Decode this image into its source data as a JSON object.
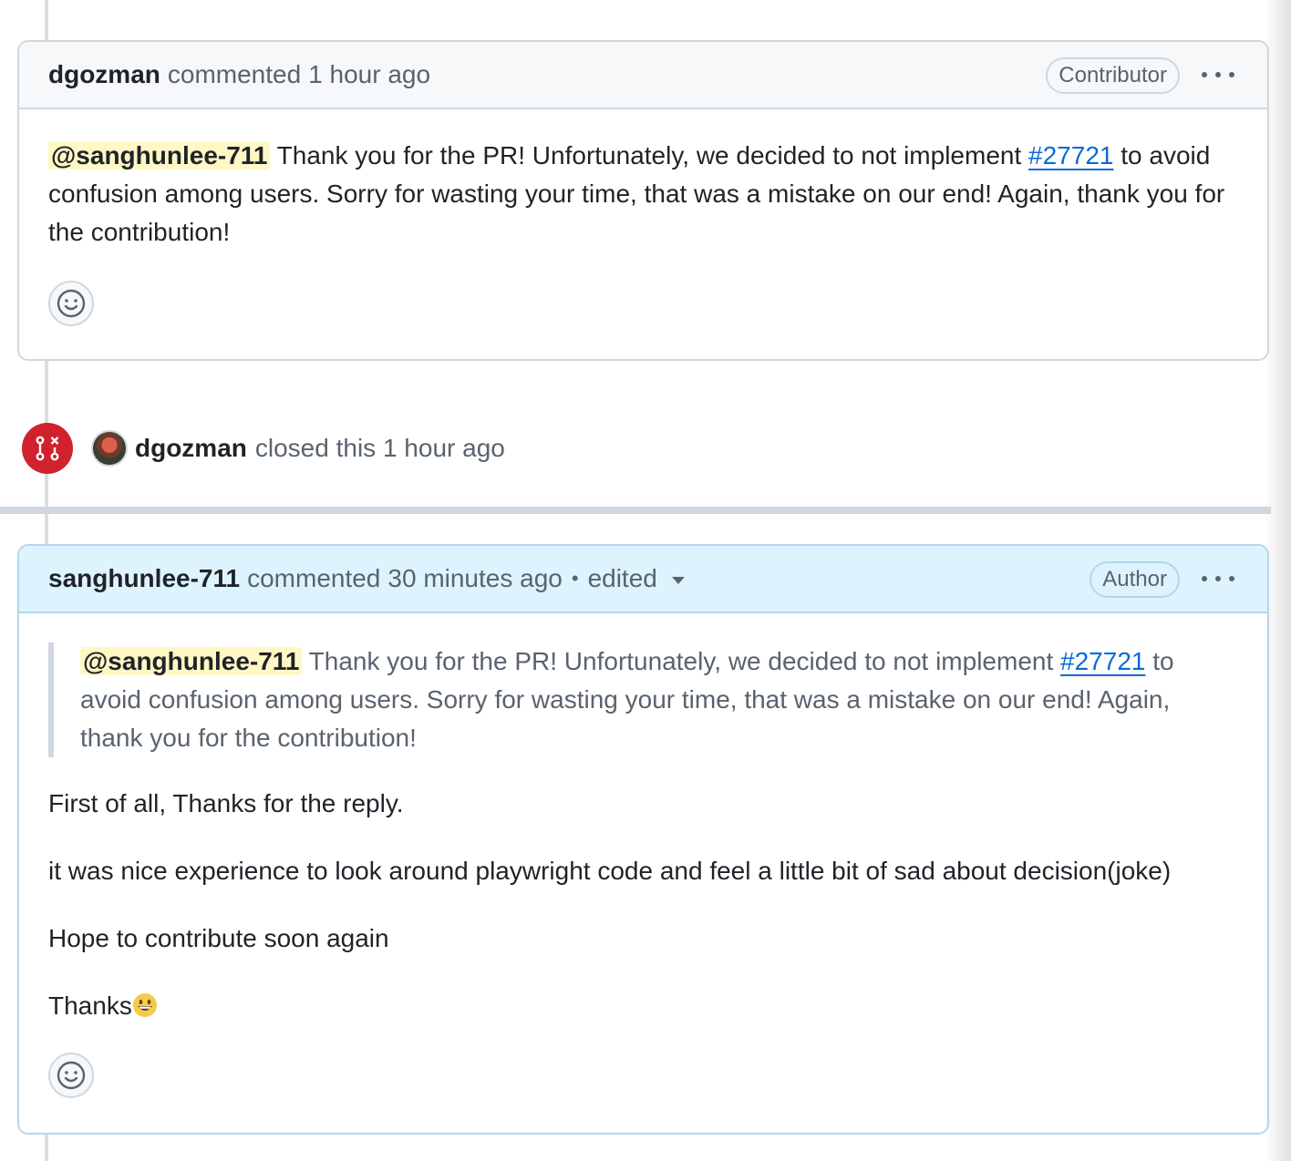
{
  "comment1": {
    "user": "dgozman",
    "action": "commented",
    "time": "1 hour ago",
    "role": "Contributor",
    "mention": "@sanghunlee-711",
    "text_before_link": " Thank you for the PR! Unfortunately, we decided to not implement ",
    "link": "#27721",
    "text_after_link": " to avoid confusion among users. Sorry for wasting your time, that was a mistake on our end! Again, thank you for the contribution!"
  },
  "event": {
    "user": "dgozman",
    "text": "closed this 1 hour ago",
    "icon": "git-pull-request-closed-icon",
    "color": "#cf222e"
  },
  "comment2": {
    "user": "sanghunlee-711",
    "action": "commented",
    "time": "30 minutes ago",
    "separator": "•",
    "edited": "edited",
    "role": "Author",
    "quote": {
      "mention": "@sanghunlee-711",
      "text_before_link": " Thank you for the PR! Unfortunately, we decided to not implement ",
      "link": "#27721",
      "text_after_link": " to avoid confusion among users. Sorry for wasting your time, that was a mistake on our end! Again, thank you for the contribution!"
    },
    "paragraphs": [
      "First of all, Thanks for the reply.",
      "it was nice experience to look around playwright code and feel a little bit of sad about decision(joke)",
      "Hope to contribute soon again"
    ],
    "closing": "Thanks",
    "closing_emoji": "grinning-face-icon"
  },
  "colors": {
    "link": "#0969da",
    "mention_bg": "#fff8c5",
    "author_header_bg": "#ddf4ff",
    "muted": "#59636e"
  }
}
